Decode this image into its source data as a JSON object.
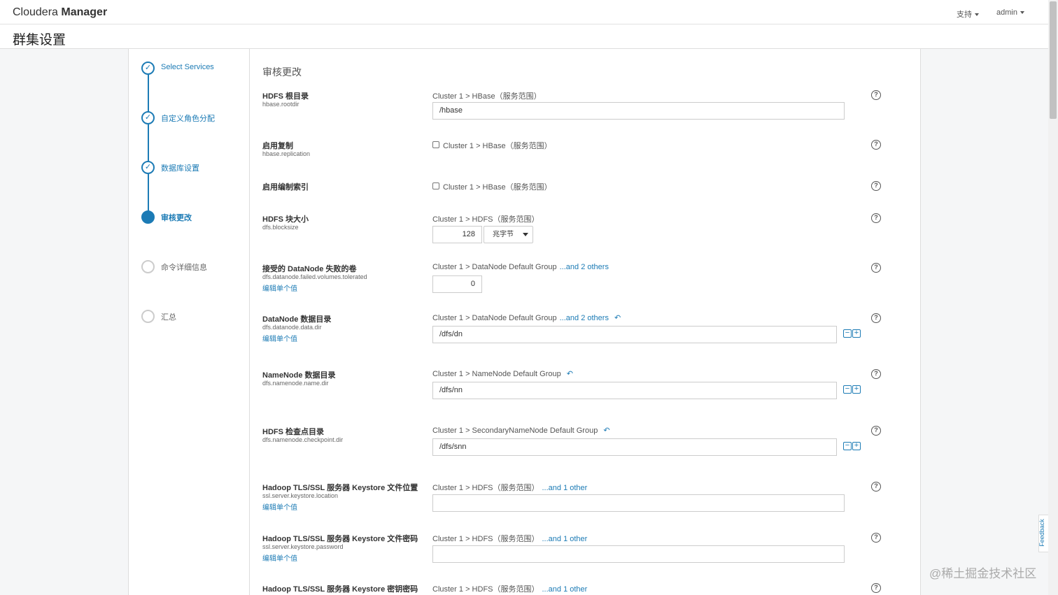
{
  "app": {
    "brand_light": "Cloudera ",
    "brand_bold": "Manager",
    "support": "支持",
    "user": "admin"
  },
  "page": {
    "title": "群集设置"
  },
  "steps": [
    {
      "label": "Select Services",
      "state": "done"
    },
    {
      "label": "自定义角色分配",
      "state": "done"
    },
    {
      "label": "数据库设置",
      "state": "done"
    },
    {
      "label": "审核更改",
      "state": "active"
    },
    {
      "label": "命令详细信息",
      "state": "todo"
    },
    {
      "label": "汇总",
      "state": "todo"
    }
  ],
  "section": {
    "title": "审核更改"
  },
  "props": [
    {
      "name": "HDFS 根目录",
      "key": "hbase.rootdir",
      "scope": "Cluster 1 > HBase（服务范围）",
      "value": "/hbase"
    },
    {
      "name": "启用复制",
      "key": "hbase.replication",
      "scope": "Cluster 1 > HBase（服务范围）"
    },
    {
      "name": "启用编制索引",
      "scope": "Cluster 1 > HBase（服务范围）"
    },
    {
      "name": "HDFS 块大小",
      "key": "dfs.blocksize",
      "scope": "Cluster 1 > HDFS（服务范围）",
      "value": "128",
      "unit": "兆字节"
    },
    {
      "name": "接受的 DataNode 失败的卷",
      "key": "dfs.datanode.failed.volumes.tolerated",
      "edit": "编辑单个值",
      "scope": "Cluster 1 > DataNode Default Group",
      "more": "...and 2 others",
      "value": "0"
    },
    {
      "name": "DataNode 数据目录",
      "key": "dfs.datanode.data.dir",
      "edit": "编辑单个值",
      "scope": "Cluster 1 > DataNode Default Group",
      "more": "...and 2 others",
      "value": "/dfs/dn"
    },
    {
      "name": "NameNode 数据目录",
      "key": "dfs.namenode.name.dir",
      "scope": "Cluster 1 > NameNode Default Group",
      "value": "/dfs/nn"
    },
    {
      "name": "HDFS 检查点目录",
      "key": "dfs.namenode.checkpoint.dir",
      "scope": "Cluster 1 > SecondaryNameNode Default Group",
      "value": "/dfs/snn"
    },
    {
      "name": "Hadoop TLS/SSL 服务器 Keystore 文件位置",
      "key": "ssl.server.keystore.location",
      "edit": "编辑单个值",
      "scope": "Cluster 1 > HDFS（服务范围）",
      "more": "...and 1 other",
      "value": ""
    },
    {
      "name": "Hadoop TLS/SSL 服务器 Keystore 文件密码",
      "key": "ssl.server.keystore.password",
      "edit": "编辑单个值",
      "scope": "Cluster 1 > HDFS（服务范围）",
      "more": "...and 1 other",
      "value": ""
    },
    {
      "name": "Hadoop TLS/SSL 服务器 Keystore 密钥密码",
      "scope": "Cluster 1 > HDFS（服务范围）",
      "more": "...and 1 other"
    }
  ],
  "feedback": "Feedback",
  "watermark": "@稀土掘金技术社区",
  "colors": {
    "accent": "#1c7bb5",
    "panel_bg": "#f5f6f7"
  }
}
